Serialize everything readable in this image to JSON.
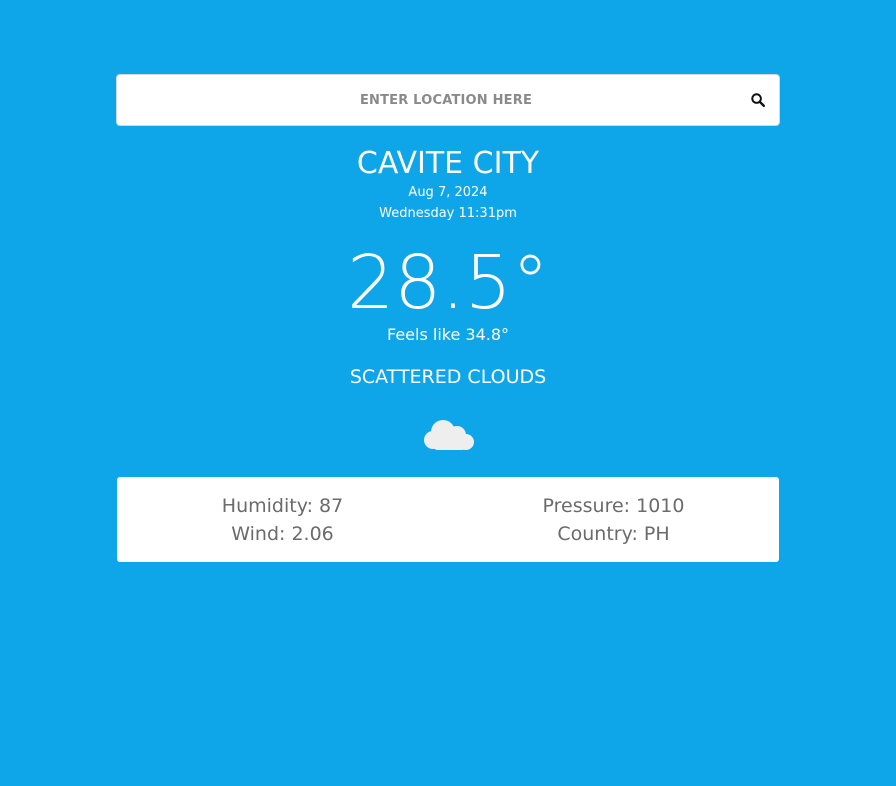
{
  "search": {
    "placeholder": "ENTER LOCATION HERE",
    "icon": "search-icon"
  },
  "location": {
    "city": "CAVITE CITY",
    "date": "Aug 7, 2024",
    "day_time": "Wednesday 11:31pm"
  },
  "weather": {
    "temperature": "28.5°",
    "feels_like": "Feels like 34.8°",
    "description": "SCATTERED CLOUDS",
    "icon": "cloud-icon"
  },
  "details": {
    "humidity": "Humidity: 87",
    "pressure": "Pressure: 1010",
    "wind": "Wind: 2.06",
    "country": "Country: PH"
  },
  "colors": {
    "background": "#0ea5e9",
    "card": "#ffffff",
    "stat_text": "#6b6b6b"
  }
}
